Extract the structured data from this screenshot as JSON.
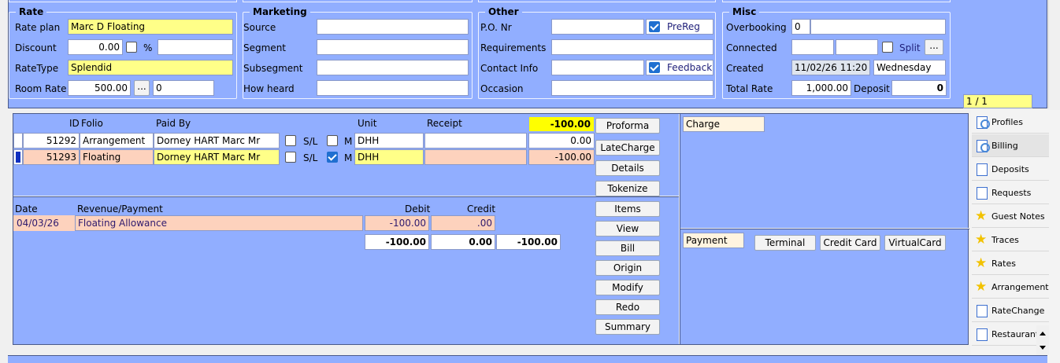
{
  "rate": {
    "title": "Rate",
    "rate_plan_label": "Rate plan",
    "rate_plan": "Marc D Floating",
    "discount_label": "Discount",
    "discount": "0.00",
    "percent": "%",
    "ratetype_label": "RateType",
    "ratetype": "Splendid",
    "room_rate_label": "Room Rate",
    "room_rate": "500.00",
    "room_rate_btn": "...",
    "room_rate_extra": "0"
  },
  "marketing": {
    "title": "Marketing",
    "source": "Source",
    "segment": "Segment",
    "subsegment": "Subsegment",
    "how_heard": "How heard"
  },
  "other": {
    "title": "Other",
    "po": "P.O. Nr",
    "prereg": "PreReg",
    "requirements": "Requirements",
    "contact": "Contact Info",
    "feedback": "Feedback",
    "occasion": "Occasion"
  },
  "misc": {
    "title": "Misc",
    "overbooking_label": "Overbooking",
    "overbooking": "0",
    "connected_label": "Connected",
    "split": "Split",
    "split_btn": "...",
    "created_label": "Created",
    "created": "11/02/26 11:20",
    "weekday": "Wednesday",
    "total_rate_label": "Total Rate",
    "total_rate": "1,000.00",
    "deposit_label": "Deposit",
    "deposit": "0"
  },
  "pager": "1 / 1",
  "folio": {
    "headers": {
      "id": "ID",
      "folio": "Folio",
      "paid_by": "Paid By",
      "unit": "Unit",
      "receipt": "Receipt"
    },
    "total": "-100.00",
    "rows": [
      {
        "id": "51292",
        "folio": "Arrangement",
        "paid_by": "Dorney HART Marc Mr",
        "sl": "S/L",
        "m": "M",
        "unit": "DHH",
        "amount": "0.00"
      },
      {
        "id": "51293",
        "folio": "Floating",
        "paid_by": "Dorney HART Marc Mr",
        "sl": "S/L",
        "m": "M",
        "unit": "DHH",
        "amount": "-100.00"
      }
    ]
  },
  "postings": {
    "headers": {
      "date": "Date",
      "revenue": "Revenue/Payment",
      "debit": "Debit",
      "credit": "Credit"
    },
    "rows": [
      {
        "date": "04/03/26",
        "revenue": "Floating Allowance",
        "debit": "-100.00",
        "credit": ".00"
      }
    ],
    "totals": {
      "debit": "-100.00",
      "credit": "0.00",
      "balance": "-100.00"
    }
  },
  "buttons": {
    "proforma": "Proforma",
    "latecharge": "LateCharge",
    "details": "Details",
    "tokenize": "Tokenize",
    "items": "Items",
    "view": "View",
    "bill": "Bill",
    "origin": "Origin",
    "modify": "Modify",
    "redo": "Redo",
    "summary": "Summary"
  },
  "charge": {
    "label": "Charge"
  },
  "payment": {
    "label": "Payment",
    "terminal": "Terminal",
    "credit_card": "Credit Card",
    "virtual_card": "VirtualCard"
  },
  "sidebar": {
    "items": [
      {
        "label": "Profiles",
        "icon": "magnifier-doc-icon"
      },
      {
        "label": "Billing",
        "icon": "magnifier-doc-icon"
      },
      {
        "label": "Deposits",
        "icon": "document-icon"
      },
      {
        "label": "Requests",
        "icon": "document-icon"
      },
      {
        "label": "Guest Notes",
        "icon": "star-icon"
      },
      {
        "label": "Traces",
        "icon": "star-icon"
      },
      {
        "label": "Rates",
        "icon": "star-icon"
      },
      {
        "label": "Arrangement",
        "icon": "star-icon"
      },
      {
        "label": "RateChange",
        "icon": "document-icon"
      },
      {
        "label": "Restaurant",
        "icon": "document-icon"
      }
    ]
  }
}
